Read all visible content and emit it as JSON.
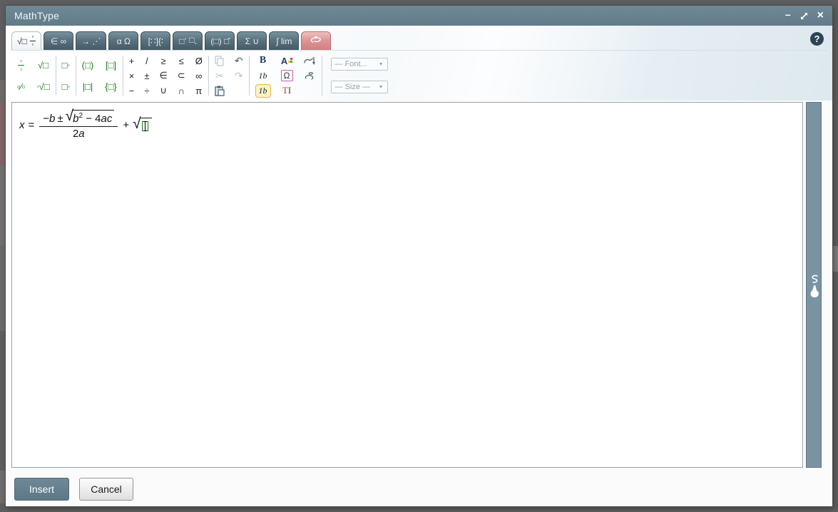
{
  "titlebar": {
    "title": "MathType",
    "minimize": "–",
    "close": "×"
  },
  "help_label": "?",
  "tabs": [
    {
      "main": "√□",
      "frac_top": "▫",
      "frac_bottom": "▫"
    },
    {
      "label": "∈ ∞"
    },
    {
      "label": "→ ⋰"
    },
    {
      "label": "α Ω"
    },
    {
      "label": "[∷]{∶"
    },
    {
      "box": "□",
      "small": "▫"
    },
    {
      "label": "(□) □̂"
    },
    {
      "label": "Σ ∪"
    },
    {
      "label": "∫ lim"
    },
    {
      "icon": "swirl-gesture-icon"
    }
  ],
  "palette": {
    "frac_top": "▫",
    "frac_bottom": "▫",
    "slash_frac": "▫∕▫",
    "sqrt": "√□",
    "nth_index": "▫",
    "nth_body": "√□",
    "script_base": "□",
    "script_small": "▫",
    "paren": "(□)",
    "bracket": "[□]",
    "abs": "|□|",
    "brace": "{□}"
  },
  "operators": [
    "+",
    "×",
    "−",
    "/",
    "±",
    "÷",
    "≥",
    "∈",
    "∪",
    "≤",
    "⊂",
    "∩",
    "Ø",
    "∞",
    "π"
  ],
  "edit": {
    "cut": "✂",
    "undo": "↶",
    "redo": "↷"
  },
  "style": {
    "bold": "B",
    "style_sample": "1b",
    "style_active": "1b",
    "omega": "Ω",
    "text_t": "T",
    "text_i": "I",
    "color_letter": "A"
  },
  "dropdowns": {
    "font": "— Font...",
    "size": "— Size —",
    "caret": "▼"
  },
  "equation": {
    "lhs": "x",
    "equals": "=",
    "minus": "−",
    "b": "b",
    "plusminus": "±",
    "sqrt_sign": "√",
    "rad_base": "b",
    "rad_exp": "2",
    "rad_minus": "−",
    "rad_coef": "4",
    "rad_vars": "ac",
    "den_coef": "2",
    "den_var": "a",
    "plus": "+"
  },
  "footer": {
    "insert": "Insert",
    "cancel": "Cancel"
  },
  "colors": {
    "titlebar": "#67818f",
    "template_green": "#1c7c1c",
    "handwriting_tab_red": "#de9597",
    "style_highlight_yellow": "#e4b93c",
    "side_panel_blue": "#7a93a3"
  }
}
